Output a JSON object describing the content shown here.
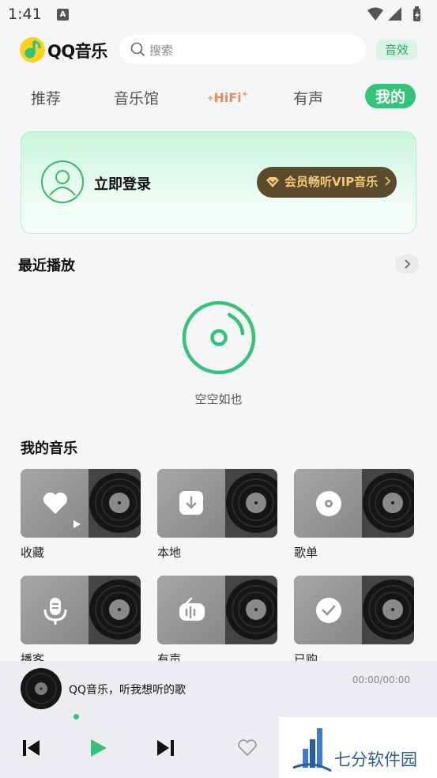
{
  "status_bar": {
    "time": "1:41",
    "app_icon": "A"
  },
  "header": {
    "logo_text": "QQ音乐",
    "search_placeholder": "搜索",
    "effects_label": "音效"
  },
  "tabs": [
    {
      "label": "推荐",
      "active": false
    },
    {
      "label": "音乐馆",
      "active": false
    },
    {
      "label": "HiFi",
      "active": false
    },
    {
      "label": "有声",
      "active": false
    },
    {
      "label": "我的",
      "active": true
    }
  ],
  "login_card": {
    "login_label": "立即登录",
    "vip_label": "会员畅听VIP音乐"
  },
  "recent": {
    "title": "最近播放",
    "empty_text": "空空如也"
  },
  "my_music": {
    "title": "我的音乐",
    "items": [
      {
        "label": "收藏",
        "icon": "heart-icon"
      },
      {
        "label": "本地",
        "icon": "download-icon"
      },
      {
        "label": "歌单",
        "icon": "disc-icon"
      },
      {
        "label": "播客",
        "icon": "microphone-icon"
      },
      {
        "label": "有声",
        "icon": "radio-icon"
      },
      {
        "label": "已购",
        "icon": "check-icon"
      }
    ]
  },
  "player": {
    "title": "QQ音乐，听我想听的歌",
    "time": "00:00/00:00"
  },
  "watermark": {
    "text": "七分软件园"
  },
  "colors": {
    "accent": "#33c47a",
    "vip_bg": "#5c4a2c",
    "vip_text": "#f3c978",
    "hifi": "#e5905b"
  }
}
